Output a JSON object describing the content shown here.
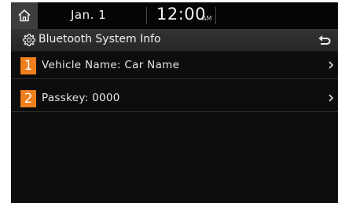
{
  "status_bar": {
    "date": "Jan.  1",
    "time": "12:00",
    "ampm": "AM"
  },
  "header": {
    "title": "Bluetooth System Info"
  },
  "items": [
    {
      "number": "1",
      "label": "Vehicle Name: Car Name"
    },
    {
      "number": "2",
      "label": "Passkey: 0000"
    }
  ],
  "colors": {
    "accent": "#f07f1d",
    "background": "#0d0d0d",
    "title_bar": "#2e2e2e",
    "text": "#e6e6e6"
  },
  "icons": {
    "home": "home-icon",
    "settings": "gear-icon",
    "back": "back-icon",
    "chevron": "chevron-right-icon"
  }
}
